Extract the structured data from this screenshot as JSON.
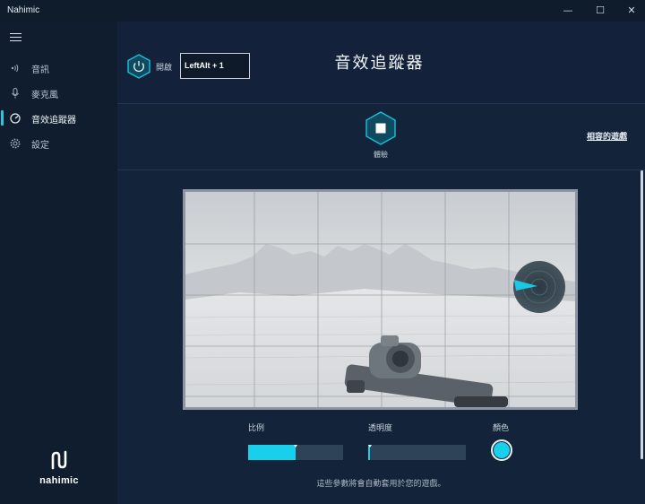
{
  "window": {
    "title": "Nahimic",
    "controls": {
      "minimize": "—",
      "maximize": "☐",
      "close": "✕"
    }
  },
  "sidebar": {
    "menu_icon": "hamburger-icon",
    "items": [
      {
        "label": "音訊",
        "icon": "audio-icon",
        "active": false
      },
      {
        "label": "麥克風",
        "icon": "microphone-icon",
        "active": false
      },
      {
        "label": "音效追蹤器",
        "icon": "sound-tracker-icon",
        "active": true
      },
      {
        "label": "設定",
        "icon": "gear-icon",
        "active": false
      }
    ],
    "brand": {
      "wordmark": "nahimic"
    }
  },
  "header": {
    "power_label": "開啟",
    "hotkey_value": "LeftAlt + 1",
    "title": "音效追蹤器"
  },
  "experience": {
    "label": "體驗",
    "compatible_games_link": "相容的遊戲"
  },
  "controls": {
    "scale_label": "比例",
    "scale_value": 0.5,
    "opacity_label": "透明度",
    "opacity_value": 0.0,
    "color_label": "顏色",
    "color": "#19d0ec"
  },
  "footnote": "這些參數將會自動套用於您的遊戲。",
  "colors": {
    "accent": "#19d0ec",
    "background": "#13233a",
    "sidebar": "#0f1d2e"
  }
}
